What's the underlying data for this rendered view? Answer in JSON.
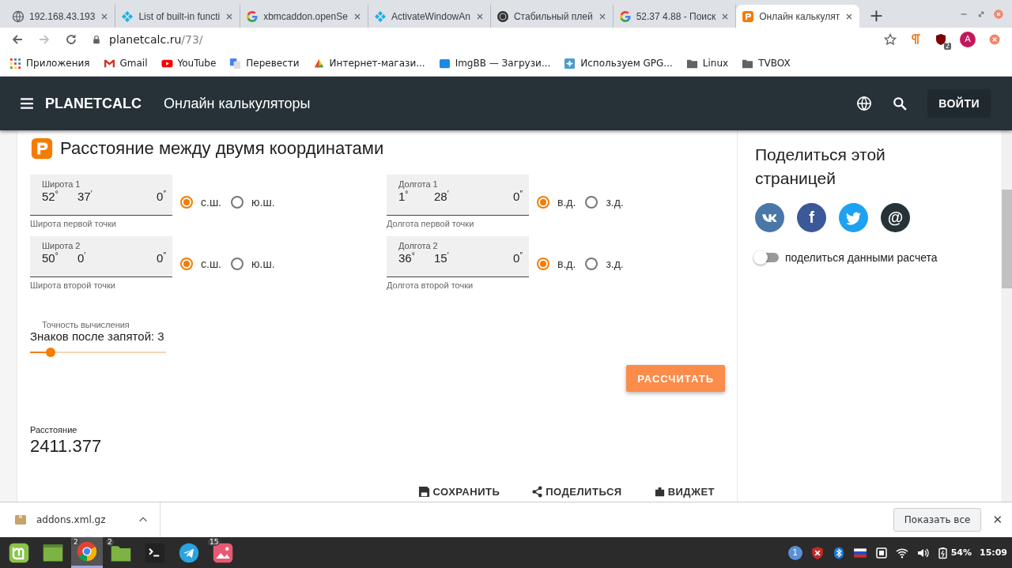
{
  "browser": {
    "tabs": [
      {
        "kind": "globe",
        "title": "192.168.43.193",
        "selected": false
      },
      {
        "kind": "kodi",
        "title": "List of built-in functi",
        "selected": false
      },
      {
        "kind": "google",
        "title": "xbmcaddon.openSe",
        "selected": false
      },
      {
        "kind": "kodi",
        "title": "ActivateWindowAn",
        "selected": false
      },
      {
        "kind": "disc",
        "title": "Стабильный плей",
        "selected": false
      },
      {
        "kind": "google",
        "title": "52.37 4.88 - Поиск",
        "selected": false
      },
      {
        "kind": "planet",
        "title": "Онлайн калькулят",
        "selected": true
      }
    ],
    "new_tab": "+",
    "address": {
      "host": "planetcalc.ru",
      "path": "/73/"
    },
    "extension_badge": "2",
    "profile_initial": "A",
    "bookmarks": [
      {
        "kind": "apps",
        "label": "Приложения"
      },
      {
        "kind": "gmail",
        "label": "Gmail"
      },
      {
        "kind": "youtube",
        "label": "YouTube"
      },
      {
        "kind": "translate",
        "label": "Перевести"
      },
      {
        "kind": "shop",
        "label": "Интернет-магази..."
      },
      {
        "kind": "ibb",
        "label": "ImgBB — Загрузи..."
      },
      {
        "kind": "gpg",
        "label": "Используем GPG..."
      },
      {
        "kind": "folder",
        "label": "Linux"
      },
      {
        "kind": "folder",
        "label": "TVBOX"
      }
    ]
  },
  "site_header": {
    "brand": "PLANETCALC",
    "title": "Онлайн калькуляторы",
    "login": "ВОЙТИ"
  },
  "calculator": {
    "title": "Расстояние между двумя координатами",
    "fields": [
      {
        "label": "Широта 1",
        "parts": [
          {
            "value": "52",
            "unit": "°"
          },
          {
            "value": "37",
            "unit": "′"
          },
          {
            "value": "0",
            "unit": "″"
          }
        ],
        "hint": "Широта первой точки",
        "options": [
          {
            "label": "с.ш.",
            "selected": true
          },
          {
            "label": "ю.ш.",
            "selected": false
          }
        ]
      },
      {
        "label": "Долгота 1",
        "parts": [
          {
            "value": "1",
            "unit": "°"
          },
          {
            "value": "28",
            "unit": "′"
          },
          {
            "value": "0",
            "unit": "″"
          }
        ],
        "hint": "Долгота первой точки",
        "options": [
          {
            "label": "в.д.",
            "selected": true
          },
          {
            "label": "з.д.",
            "selected": false
          }
        ]
      },
      {
        "label": "Широта 2",
        "parts": [
          {
            "value": "50",
            "unit": "°"
          },
          {
            "value": "0",
            "unit": "′"
          },
          {
            "value": "0",
            "unit": "″"
          }
        ],
        "hint": "Широта второй точки",
        "options": [
          {
            "label": "с.ш.",
            "selected": true
          },
          {
            "label": "ю.ш.",
            "selected": false
          }
        ]
      },
      {
        "label": "Долгота 2",
        "parts": [
          {
            "value": "36",
            "unit": "°"
          },
          {
            "value": "15",
            "unit": "′"
          },
          {
            "value": "0",
            "unit": "″"
          }
        ],
        "hint": "Долгота второй точки",
        "options": [
          {
            "label": "в.д.",
            "selected": true
          },
          {
            "label": "з.д.",
            "selected": false
          }
        ]
      }
    ],
    "precision": {
      "label": "Точность вычисления",
      "value": "Знаков после запятой: 3",
      "level": 0.15
    },
    "calculate_button": "РАССЧИТАТЬ",
    "result": {
      "label": "Расстояние",
      "value": "2411.377"
    },
    "actions": [
      {
        "kind": "save",
        "label": "СОХРАНИТЬ"
      },
      {
        "kind": "share",
        "label": "ПОДЕЛИТЬСЯ"
      },
      {
        "kind": "widget",
        "label": "ВИДЖЕТ"
      }
    ]
  },
  "share_panel": {
    "title": "Поделиться этой страницей",
    "networks": [
      {
        "kind": "vk",
        "color": "#4a76a8"
      },
      {
        "kind": "facebook",
        "glyph": "f",
        "color": "#3b5998"
      },
      {
        "kind": "twitter",
        "color": "#1da1f2"
      },
      {
        "kind": "email",
        "glyph": "@",
        "color": "#263238"
      }
    ],
    "toggle": {
      "label": "поделиться данными расчета",
      "on": false
    }
  },
  "download_bar": {
    "file": "addons.xml.gz",
    "show_all": "Показать все",
    "close": "✕"
  },
  "taskbar": {
    "apps": [
      {
        "kind": "mint",
        "selected": false
      },
      {
        "kind": "desktop",
        "selected": false
      },
      {
        "kind": "chrome",
        "badge": "2",
        "selected": true
      },
      {
        "kind": "folder",
        "badge": "2",
        "selected": false
      },
      {
        "kind": "terminal",
        "selected": false
      },
      {
        "kind": "telegram",
        "selected": false
      },
      {
        "kind": "photos",
        "badge": "15",
        "selected": false
      }
    ],
    "notification_badge": "1",
    "battery": "54%",
    "time": "15:09"
  }
}
